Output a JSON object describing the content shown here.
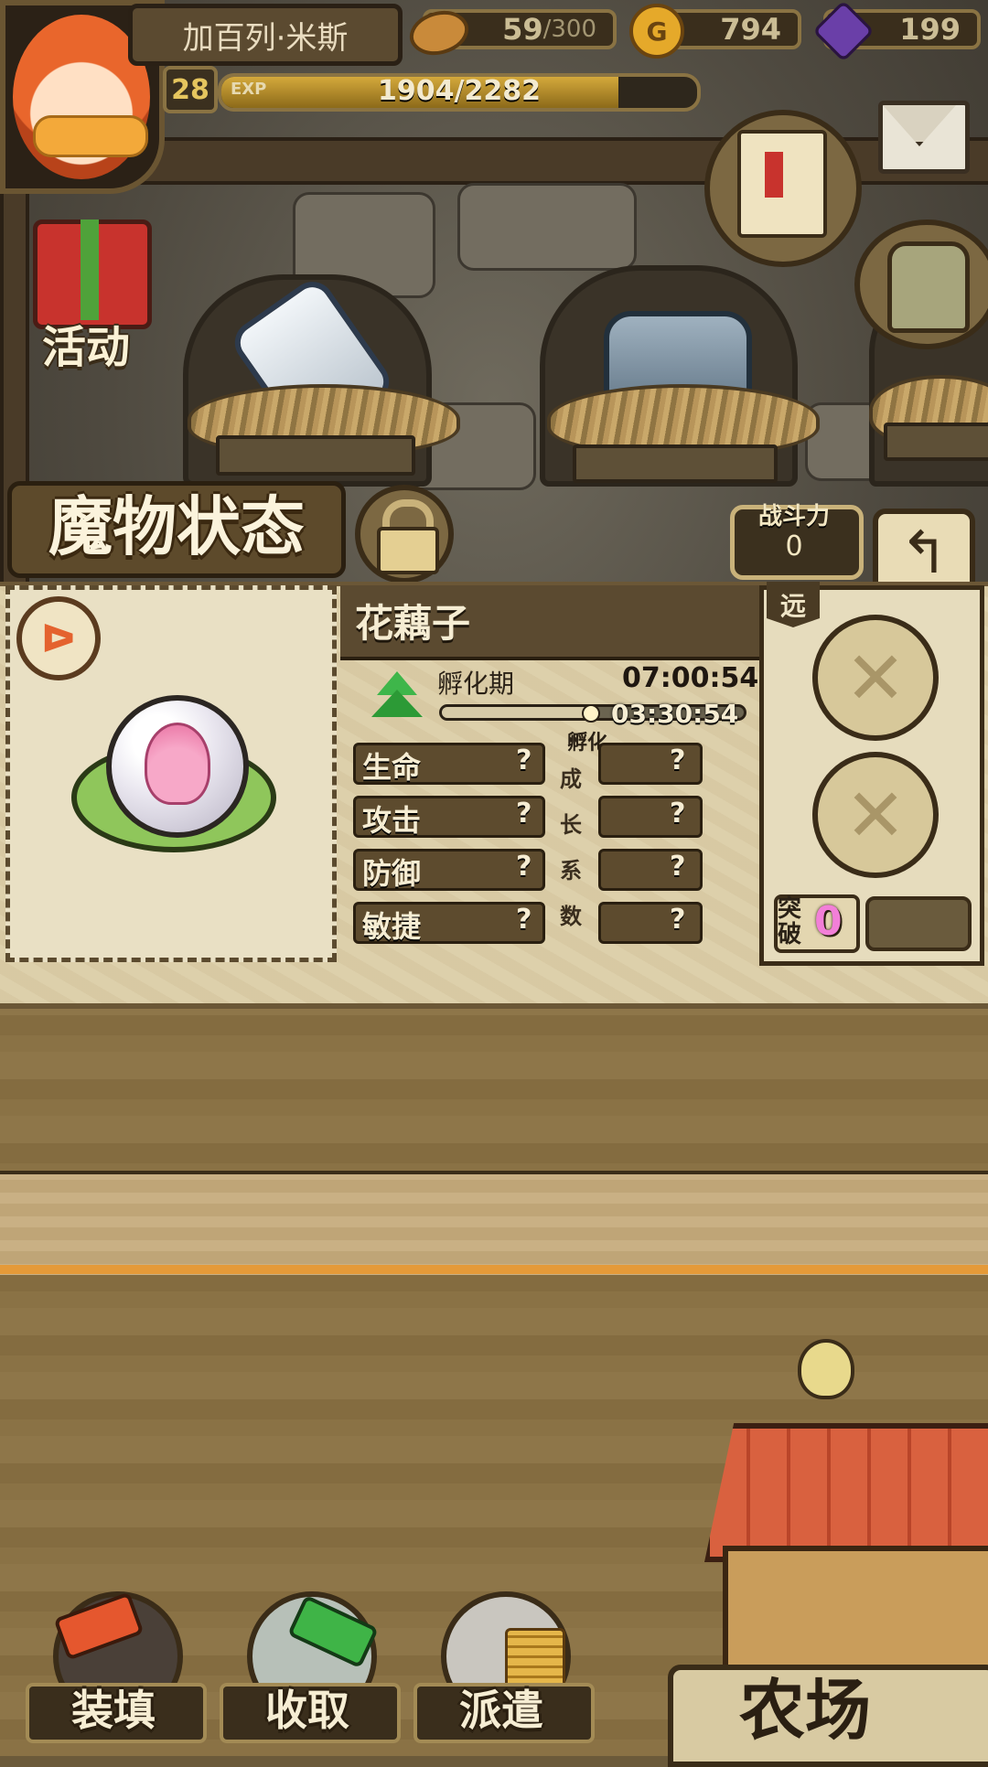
{
  "player": {
    "name": "加百列·米斯",
    "level": "28",
    "exp_tag": "EXP",
    "exp_text": "1904/2282",
    "exp_fraction": 0.834
  },
  "resources": {
    "bread": {
      "value": "59",
      "max": "/300",
      "icon": "bread-icon",
      "color": "#c98a3a"
    },
    "gold": {
      "value": "794",
      "icon": "gold-coin-icon",
      "icon_glyph": "G",
      "color": "#e5a92a"
    },
    "gems": {
      "value": "199",
      "icon": "purple-gem-icon",
      "color": "#6a3fa8"
    }
  },
  "activity": {
    "label": "活动"
  },
  "header": {
    "title": "魔物状态",
    "power_label": "战斗力",
    "power_value": "0",
    "back_glyph": "↰"
  },
  "monster": {
    "name": "花藕子",
    "rank_glyph": "▲",
    "phase_label": "孵化期",
    "timer_total": "07:00:54",
    "timer_remaining": "03:30:54",
    "progress_fraction": 0.5,
    "hatch_label": "孵化",
    "badge_glyph": "ᐅ",
    "stats": [
      {
        "label": "生命",
        "value": "?"
      },
      {
        "label": "攻击",
        "value": "?"
      },
      {
        "label": "防御",
        "value": "?"
      },
      {
        "label": "敏捷",
        "value": "?"
      }
    ],
    "growth_chars": [
      "成",
      "长",
      "系",
      "数"
    ],
    "growth": [
      "?",
      "?",
      "?",
      "?"
    ]
  },
  "skills": {
    "range_tag": "远",
    "slot_glyph": "✕",
    "breakthrough_label": "突破",
    "breakthrough_value": "0"
  },
  "bottom": {
    "load": "装填",
    "collect": "收取",
    "dispatch": "派遣",
    "farm": "农场"
  },
  "colors": {
    "accent_gold": "#d4a93c",
    "panel_bg": "#ddd0ab",
    "breakthrough_pink": "#f27fd8"
  }
}
